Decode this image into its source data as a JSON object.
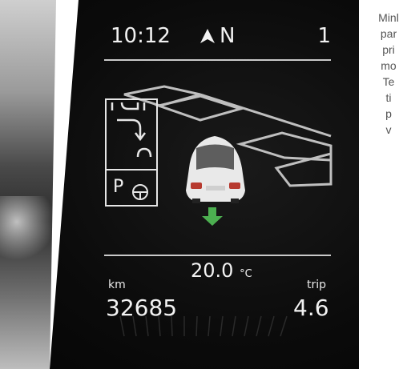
{
  "cluster": {
    "clock": "10:12",
    "heading": "N",
    "gear": "1",
    "parking_label": "P",
    "temperature": "20.0",
    "temperature_unit": "°C",
    "odometer_label": "km",
    "odometer_value": "32685",
    "trip_label": "trip",
    "trip_value": "4.6"
  },
  "caption": {
    "lines": [
      "Minl",
      "par",
      "pri",
      "mo",
      "Te",
      "ti",
      "p",
      "v"
    ]
  },
  "colors": {
    "arrow": "#4caf50",
    "background": "#0b0b0b",
    "text": "#f2f2f2"
  }
}
